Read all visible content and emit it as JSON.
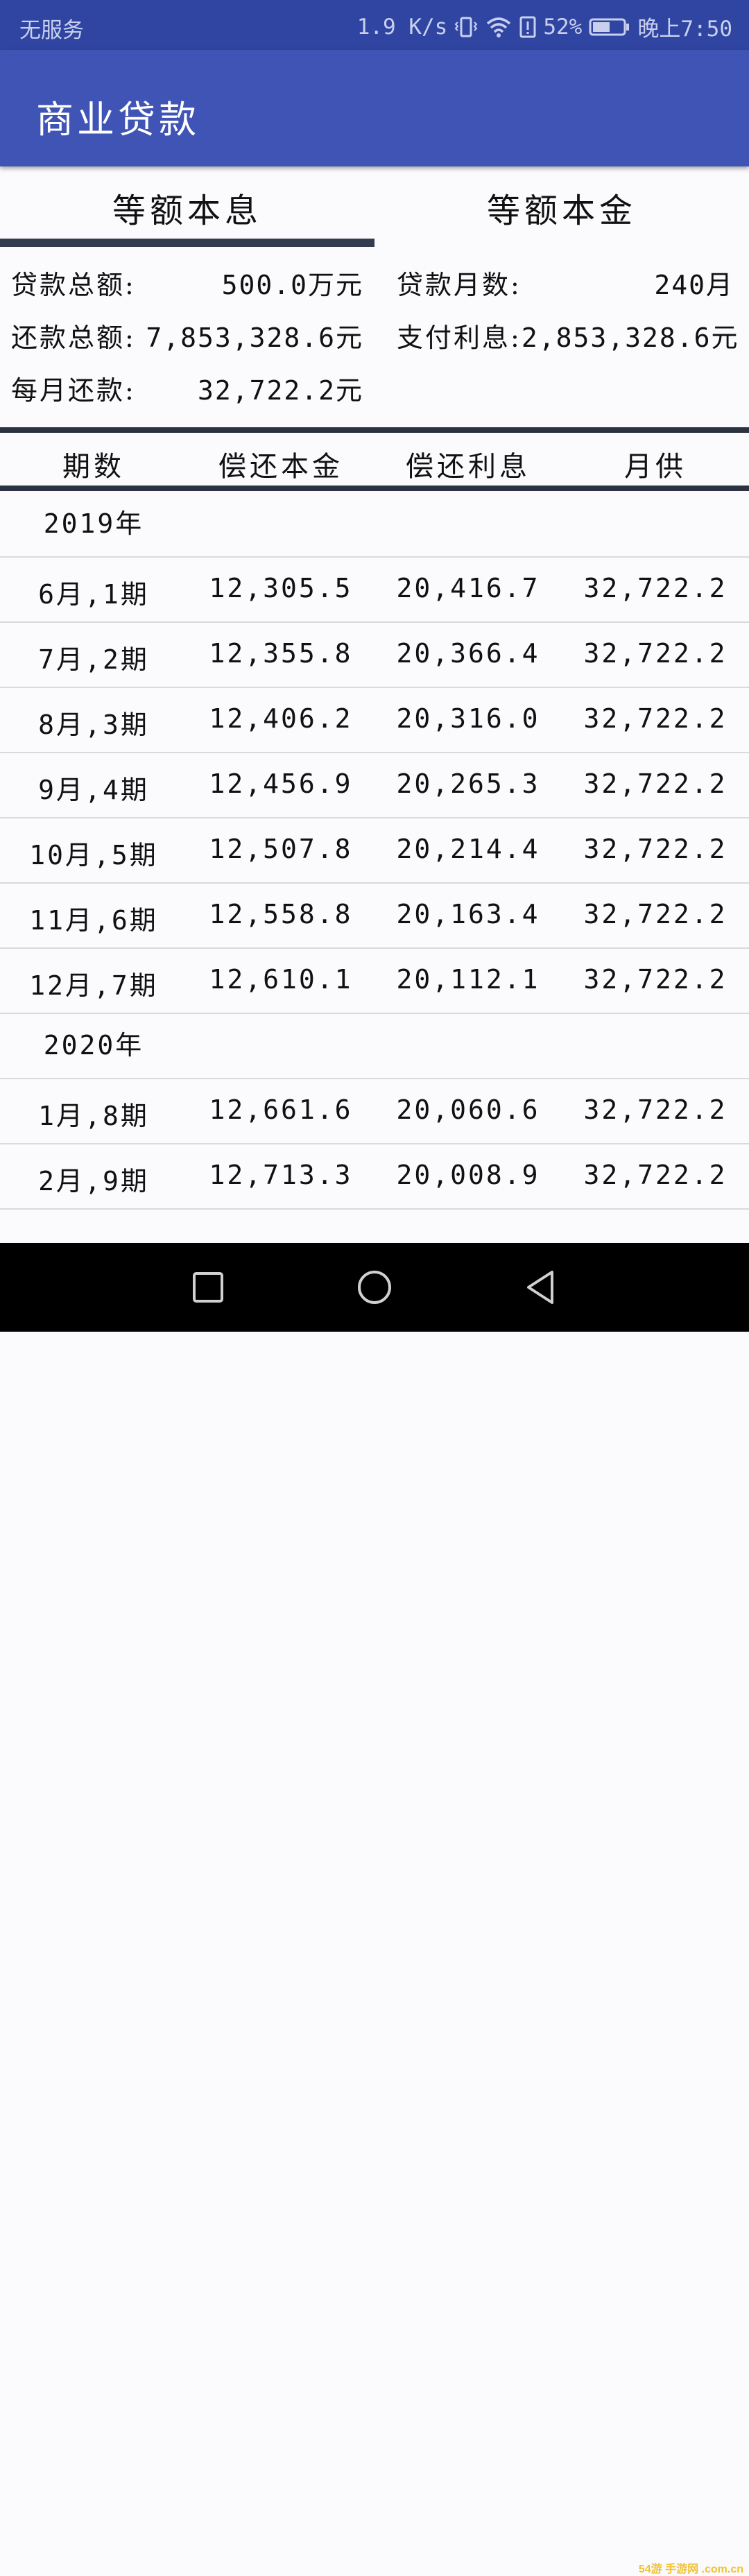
{
  "status_bar": {
    "carrier": "无服务",
    "speed": "1.9 K/s",
    "battery_percent": "52%",
    "time": "晚上7:50"
  },
  "app_bar": {
    "title": "商业贷款"
  },
  "tabs": [
    {
      "label": "等额本息",
      "selected": true
    },
    {
      "label": "等额本金",
      "selected": false
    }
  ],
  "summary": {
    "loan_total_label": "贷款总额:",
    "loan_total_value": "500.0",
    "loan_total_unit": "万元",
    "loan_months_label": "贷款月数:",
    "loan_months_value": "240",
    "loan_months_unit": "月",
    "repay_total_label": "还款总额:",
    "repay_total_value": "7,853,328.6",
    "repay_total_unit": "元",
    "interest_label": "支付利息:",
    "interest_value": "2,853,328.6",
    "interest_unit": "元",
    "monthly_label": "每月还款:",
    "monthly_value": "32,722.2",
    "monthly_unit": "元"
  },
  "table": {
    "headers": [
      "期数",
      "偿还本金",
      "偿还利息",
      "月供"
    ],
    "rows": [
      {
        "type": "year",
        "label": "2019年"
      },
      {
        "type": "period",
        "month": "6月",
        "sep": ",",
        "period": "1期",
        "principal": "12,305.5",
        "interest": "20,416.7",
        "payment": "32,722.2"
      },
      {
        "type": "period",
        "month": "7月",
        "sep": ",",
        "period": "2期",
        "principal": "12,355.8",
        "interest": "20,366.4",
        "payment": "32,722.2"
      },
      {
        "type": "period",
        "month": "8月",
        "sep": ",",
        "period": "3期",
        "principal": "12,406.2",
        "interest": "20,316.0",
        "payment": "32,722.2"
      },
      {
        "type": "period",
        "month": "9月",
        "sep": ",",
        "period": "4期",
        "principal": "12,456.9",
        "interest": "20,265.3",
        "payment": "32,722.2"
      },
      {
        "type": "period",
        "month": "10月",
        "sep": ",",
        "period": "5期",
        "principal": "12,507.8",
        "interest": "20,214.4",
        "payment": "32,722.2"
      },
      {
        "type": "period",
        "month": "11月",
        "sep": ",",
        "period": "6期",
        "principal": "12,558.8",
        "interest": "20,163.4",
        "payment": "32,722.2"
      },
      {
        "type": "period",
        "month": "12月",
        "sep": ",",
        "period": "7期",
        "principal": "12,610.1",
        "interest": "20,112.1",
        "payment": "32,722.2"
      },
      {
        "type": "year",
        "label": "2020年"
      },
      {
        "type": "period",
        "month": "1月",
        "sep": ",",
        "period": "8期",
        "principal": "12,661.6",
        "interest": "20,060.6",
        "payment": "32,722.2"
      },
      {
        "type": "period",
        "month": "2月",
        "sep": ",",
        "period": "9期",
        "principal": "12,713.3",
        "interest": "20,008.9",
        "payment": "32,722.2"
      }
    ]
  },
  "nav_bar": {
    "buttons": [
      "recent-apps",
      "home",
      "back"
    ]
  },
  "watermark": "54游 手游网 .com.cn",
  "colors": {
    "status_bar": "#2f45a1",
    "app_bar": "#3f54b5",
    "indicator": "#333b4f",
    "background": "#fbfafc"
  }
}
